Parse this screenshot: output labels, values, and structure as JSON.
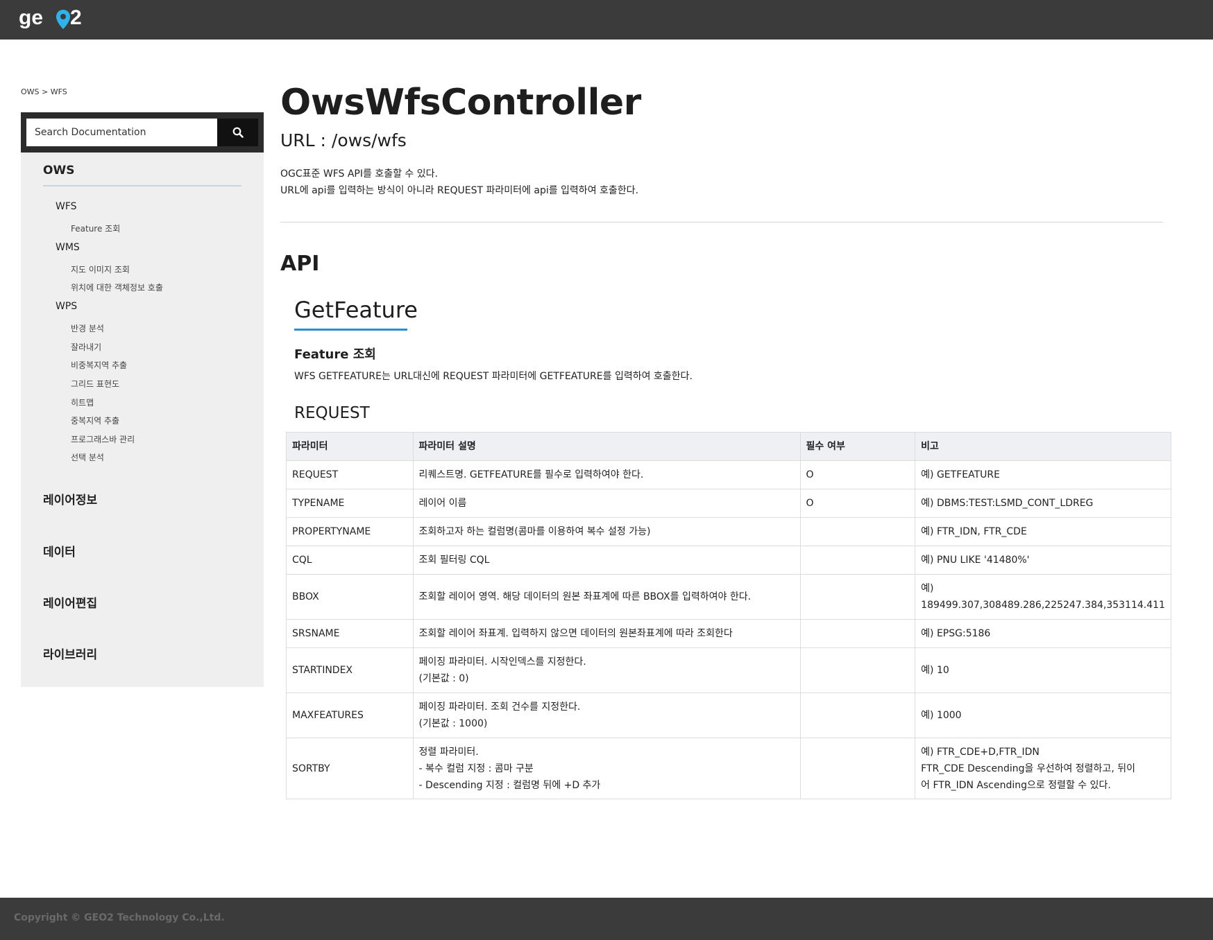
{
  "header": {
    "logo_text": "GEO2"
  },
  "breadcrumb": "OWS > WFS",
  "search": {
    "placeholder": "Search Documentation"
  },
  "sidebar": {
    "ows_label": "OWS",
    "wfs_label": "WFS",
    "wfs_items": [
      "Feature 조회"
    ],
    "wms_label": "WMS",
    "wms_items": [
      "지도 이미지 조회",
      "위치에 대한 객체정보 호출"
    ],
    "wps_label": "WPS",
    "wps_items": [
      "반경 분석",
      "잘라내기",
      "비중복지역 추출",
      "그리드 표현도",
      "히트맵",
      "중복지역 추출",
      "프로그래스바 관리",
      "선택 분석"
    ],
    "sections": [
      "레이어정보",
      "데이터",
      "레이어편집",
      "라이브러리"
    ]
  },
  "main": {
    "title": "OwsWfsController",
    "url": "URL : /ows/wfs",
    "desc_line1": "OGC표준 WFS API를 호출할 수 있다.",
    "desc_line2": "URL에 api를 입력하는 방식이 아니라 REQUEST 파라미터에 api를 입력하여 호출한다.",
    "api_heading": "API",
    "getfeature_heading": "GetFeature",
    "feature_title": "Feature 조회",
    "feature_desc": "WFS GETFEATURE는 URL대신에 REQUEST 파라미터에 GETFEATURE를 입력하여 호출한다.",
    "request_heading": "REQUEST"
  },
  "table": {
    "headers": [
      "파라미터",
      "파라미터 설명",
      "필수 여부",
      "비고"
    ],
    "rows": [
      [
        "REQUEST",
        "리퀘스트명. GETFEATURE를 필수로 입력하여야 한다.",
        "O",
        "예) GETFEATURE"
      ],
      [
        "TYPENAME",
        "레이어 이름",
        "O",
        "예) DBMS:TEST:LSMD_CONT_LDREG"
      ],
      [
        "PROPERTYNAME",
        "조회하고자 하는 컬럼명(콤마를 이용하여 복수 설정 가능)",
        "",
        "예) FTR_IDN, FTR_CDE"
      ],
      [
        "CQL",
        "조회 필터링 CQL",
        "",
        "예) PNU LIKE '41480%'"
      ],
      [
        "BBOX",
        "조회할 레이어 영역. 해당 데이터의 원본 좌표계에 따른 BBOX를 입력하여야 한다.",
        "",
        "예)\n189499.307,308489.286,225247.384,353114.411"
      ],
      [
        "SRSNAME",
        "조회할 레이어 좌표계. 입력하지 않으면 데이터의 원본좌표계에 따라 조회한다",
        "",
        "예) EPSG:5186"
      ],
      [
        "STARTINDEX",
        "페이징 파라미터. 시작인덱스를 지정한다.\n(기본값 : 0)",
        "",
        "예) 10"
      ],
      [
        "MAXFEATURES",
        "페이징 파라미터. 조회 건수를 지정한다.\n(기본값 : 1000)",
        "",
        "예) 1000"
      ],
      [
        "SORTBY",
        "정렬 파라미터.\n- 복수 컬럼 지정 : 콤마 구분\n- Descending 지정 : 컬럼명 뒤에 +D 추가",
        "",
        "예) FTR_CDE+D,FTR_IDN\nFTR_CDE Descending을 우선하여 정렬하고, 뒤이\n어 FTR_IDN Ascending으로 정렬할 수 있다."
      ]
    ]
  },
  "footer": {
    "copyright": "Copyright © GEO2 Technology Co.,Ltd."
  },
  "colors": {
    "header_bg": "#3b3b3b",
    "accent": "#2a8fd1",
    "sidebar_bg": "#efefef"
  }
}
